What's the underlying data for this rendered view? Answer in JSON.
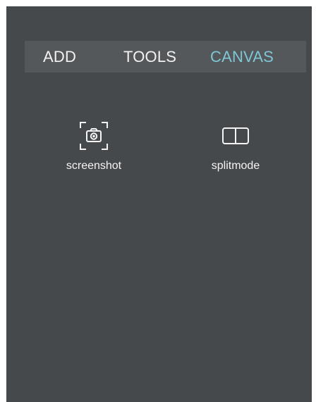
{
  "tabs": [
    {
      "label": "ADD",
      "active": false
    },
    {
      "label": "TOOLS",
      "active": false
    },
    {
      "label": "CANVAS",
      "active": true
    }
  ],
  "tools": [
    {
      "label": "screenshot",
      "icon": "camera-frame-icon"
    },
    {
      "label": "splitmode",
      "icon": "split-view-icon"
    }
  ],
  "colors": {
    "panel_bg": "#45494c",
    "tabbar_bg": "#54585b",
    "tab_text": "#f2f2f2",
    "tab_active": "#7fc6d6"
  }
}
